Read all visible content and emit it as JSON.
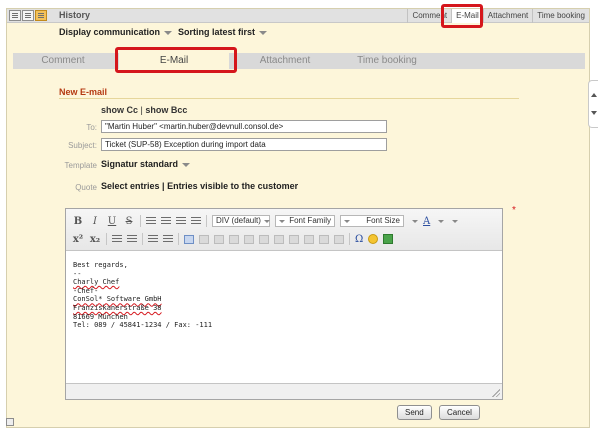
{
  "header": {
    "title": "History",
    "tabs": [
      "Comment",
      "E-Mail",
      "Attachment",
      "Time booking"
    ],
    "active_tab_index": 1
  },
  "display": {
    "label": "Display communication",
    "sort": "Sorting latest first"
  },
  "tabs": [
    "Comment",
    "E-Mail",
    "Attachment",
    "Time booking"
  ],
  "form": {
    "section_title": "New E-mail",
    "show_cc": "show Cc",
    "show_bcc": "show Bcc",
    "to_label": "To:",
    "to_value": "\"Martin Huber\" <martin.huber@devnull.consol.de>",
    "subject_label": "Subject:",
    "subject_value": "Ticket (SUP-58) Exception during import data",
    "template_label": "Template",
    "template_value": "Signatur standard",
    "quote_label": "Quote",
    "quote_select": "Select entries",
    "quote_visible": "Entries visible to the customer",
    "required_mark": "*"
  },
  "editor": {
    "toolbar": {
      "bold": "B",
      "italic": "I",
      "underline": "U",
      "strike": "S",
      "format": "DIV (default)",
      "font_family": "Font Family",
      "font_size": "Font Size",
      "sup": "x²",
      "sub": "x₂",
      "omega": "Ω",
      "text_color": "A"
    },
    "body_lines": [
      "Best regards,",
      "--",
      "Charly Chef",
      "-Chef-",
      "ConSol* Software GmbH",
      "Franziskanerstraße 38",
      "81669 München",
      "Tel: 089 / 45841-1234 / Fax: -111"
    ]
  },
  "buttons": {
    "send": "Send",
    "cancel": "Cancel"
  },
  "colors": {
    "highlight": "#d5161c",
    "panel_bg": "#fdf6da",
    "section_title": "#b53a12"
  }
}
